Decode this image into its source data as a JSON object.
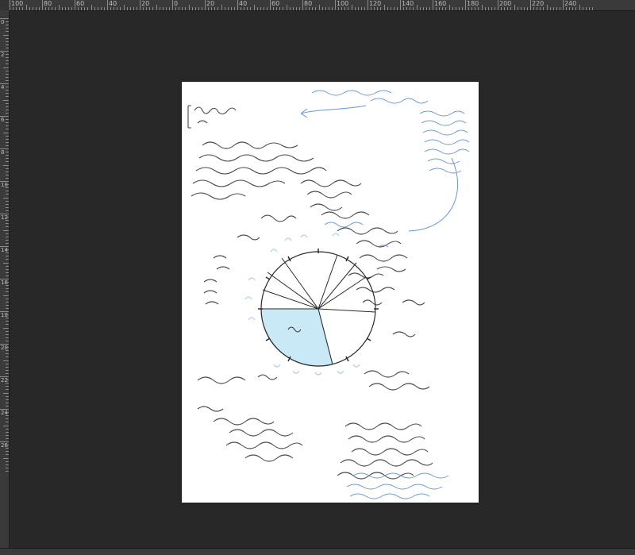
{
  "ruler": {
    "top_labels": [
      "100",
      "80",
      "60",
      "40",
      "20",
      "0",
      "20",
      "40",
      "60",
      "80",
      "100",
      "120",
      "140",
      "160",
      "180",
      "200",
      "220",
      "240"
    ],
    "left_labels": [
      "0",
      "2",
      "4",
      "6",
      "8",
      "10",
      "12",
      "14",
      "16",
      "18",
      "20",
      "22",
      "24",
      "26"
    ]
  },
  "document": {
    "background": "#ffffff"
  },
  "colors": {
    "pie_fill": "#c9e9f6",
    "pencil": "#2a2a2a",
    "annotation_blue": "#5b8bd6"
  }
}
